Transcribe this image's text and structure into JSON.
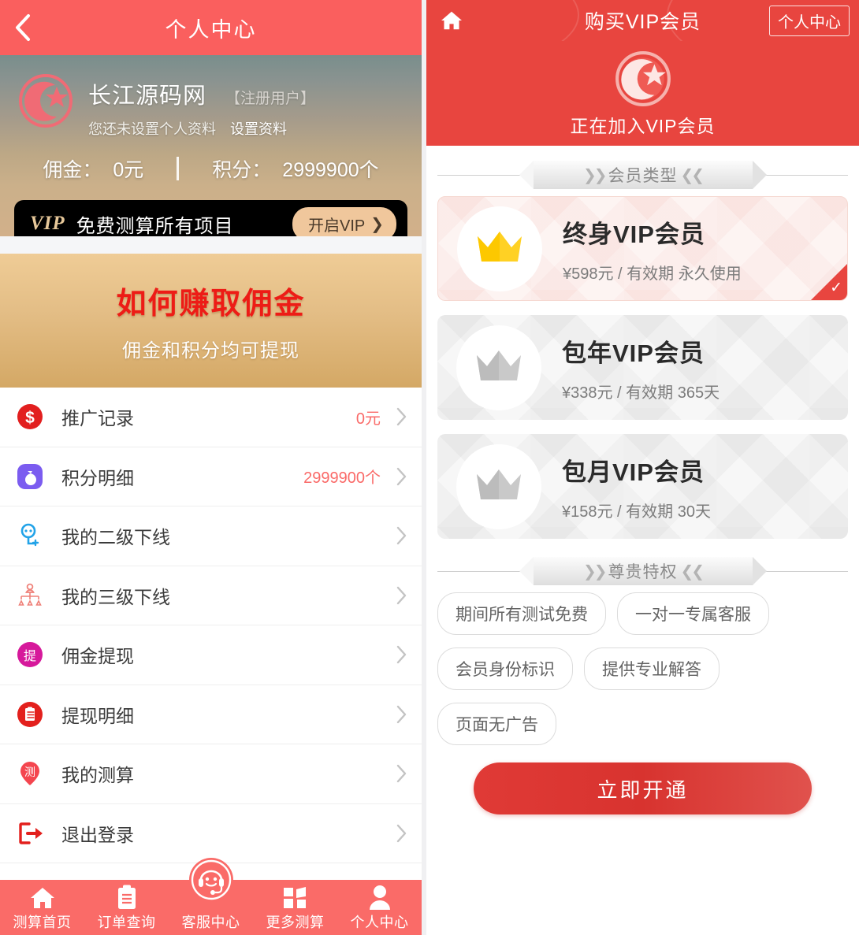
{
  "left": {
    "header": {
      "title": "个人中心",
      "back_icon": "chevron-left-icon"
    },
    "profile": {
      "name": "长江源码网",
      "tag": "【注册用户】",
      "sub_text": "您还未设置个人资料",
      "sub_link": "设置资料",
      "commission_label": "佣金：",
      "commission_value": "0元",
      "points_label": "积分：",
      "points_value": "2999900个"
    },
    "vip_banner": {
      "tag": "VIP",
      "text": "免费测算所有项目",
      "button": "开启VIP",
      "button_arrow": "❯"
    },
    "earn_banner": {
      "title": "如何赚取佣金",
      "subtitle": "佣金和积分均可提现"
    },
    "menu": [
      {
        "icon": "dollar-coin-icon",
        "label": "推广记录",
        "value": "0元"
      },
      {
        "icon": "money-bag-icon",
        "label": "积分明细",
        "value": "2999900个"
      },
      {
        "icon": "person-add-icon",
        "label": "我的二级下线",
        "value": ""
      },
      {
        "icon": "org-chart-icon",
        "label": "我的三级下线",
        "value": ""
      },
      {
        "icon": "withdraw-badge-icon",
        "label": "佣金提现",
        "value": ""
      },
      {
        "icon": "document-icon",
        "label": "提现明细",
        "value": ""
      },
      {
        "icon": "map-pin-icon",
        "label": "我的测算",
        "value": ""
      },
      {
        "icon": "logout-icon",
        "label": "退出登录",
        "value": ""
      }
    ],
    "tabbar": [
      {
        "icon": "home-icon",
        "label": "测算首页"
      },
      {
        "icon": "clipboard-icon",
        "label": "订单查询"
      },
      {
        "icon": "headset-support-icon",
        "label": "客服中心"
      },
      {
        "icon": "grid-squares-icon",
        "label": "更多测算"
      },
      {
        "icon": "user-icon",
        "label": "个人中心"
      }
    ]
  },
  "right": {
    "header": {
      "home_icon": "home-icon",
      "title": "购买VIP会员",
      "action_button": "个人中心"
    },
    "hero": {
      "logo_icon": "crescent-star-logo-icon",
      "text": "正在加入VIP会员"
    },
    "sections": {
      "member_type": "会员类型",
      "privileges": "尊贵特权"
    },
    "plans": [
      {
        "icon": "crown-gold-icon",
        "title": "终身VIP会员",
        "meta": "¥598元 / 有效期 永久使用",
        "selected": true
      },
      {
        "icon": "crown-silver-icon",
        "title": "包年VIP会员",
        "meta": "¥338元 / 有效期 365天",
        "selected": false
      },
      {
        "icon": "crown-silver-icon",
        "title": "包月VIP会员",
        "meta": "¥158元 / 有效期 30天",
        "selected": false
      }
    ],
    "privileges": [
      "期间所有测试免费",
      "一对一专属客服",
      "会员身份标识",
      "提供专业解答",
      "页面无广告"
    ],
    "cta": "立即开通"
  },
  "colors": {
    "left_header": "#fa5f5e",
    "right_header": "#e8453f",
    "accent_red": "#e8453f",
    "value_red": "#fa6a68",
    "earn_title_red": "#ed1c16",
    "gold": "#f5c518",
    "tabbar": "#fa6b68"
  }
}
